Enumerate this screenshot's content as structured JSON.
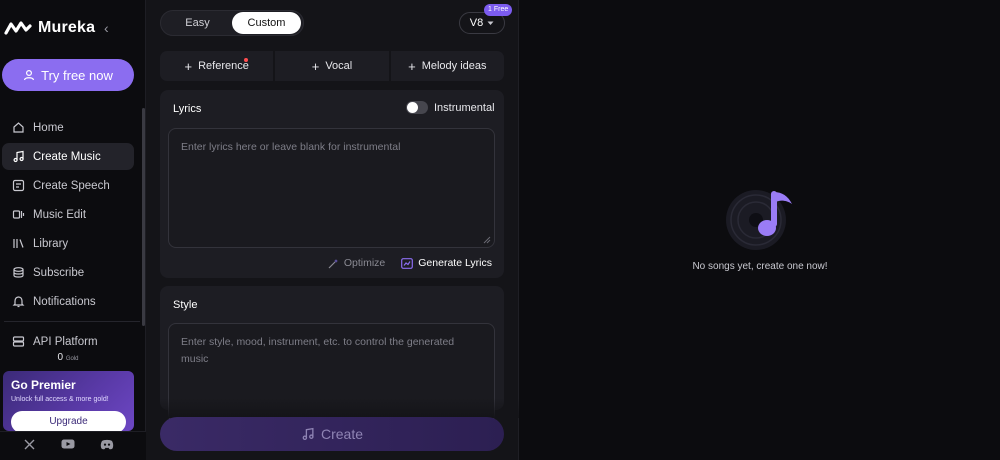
{
  "brand": {
    "name": "Mureka",
    "collapse_glyph": "‹"
  },
  "sidebar": {
    "try_button": "Try free now",
    "items": [
      {
        "label": "Home",
        "icon": "home-icon",
        "active": false
      },
      {
        "label": "Create Music",
        "icon": "music-note-icon",
        "active": true
      },
      {
        "label": "Create Speech",
        "icon": "speech-icon",
        "active": false
      },
      {
        "label": "Music Edit",
        "icon": "music-edit-icon",
        "active": false
      },
      {
        "label": "Library",
        "icon": "library-icon",
        "active": false
      },
      {
        "label": "Subscribe",
        "icon": "subscribe-icon",
        "active": false
      },
      {
        "label": "Notifications",
        "icon": "bell-icon",
        "active": false
      }
    ],
    "api_platform": "API Platform",
    "gold_value": "0",
    "gold_unit": "Gold",
    "premier": {
      "title": "Go Premier",
      "subtitle": "Unlock full access & more gold!",
      "button": "Upgrade"
    },
    "socials": [
      "x-icon",
      "youtube-icon",
      "discord-icon"
    ]
  },
  "panel": {
    "modes": [
      "Easy",
      "Custom"
    ],
    "active_mode": "Custom",
    "version": "V8",
    "free_badge": "1 Free",
    "tabs": [
      "Reference",
      "Vocal",
      "Melody ideas"
    ],
    "lyrics": {
      "title": "Lyrics",
      "instrumental_label": "Instrumental",
      "placeholder": "Enter lyrics here or leave blank for instrumental",
      "optimize": "Optimize",
      "generate": "Generate Lyrics"
    },
    "style": {
      "title": "Style",
      "placeholder": "Enter style, mood, instrument, etc. to control the generated music"
    },
    "create_button": "Create"
  },
  "empty_state": {
    "message": "No songs yet, create one now!"
  },
  "colors": {
    "accent": "#8b6df0",
    "bg": "#0c0c0f",
    "panel": "#141418",
    "card": "#1d1d23"
  }
}
